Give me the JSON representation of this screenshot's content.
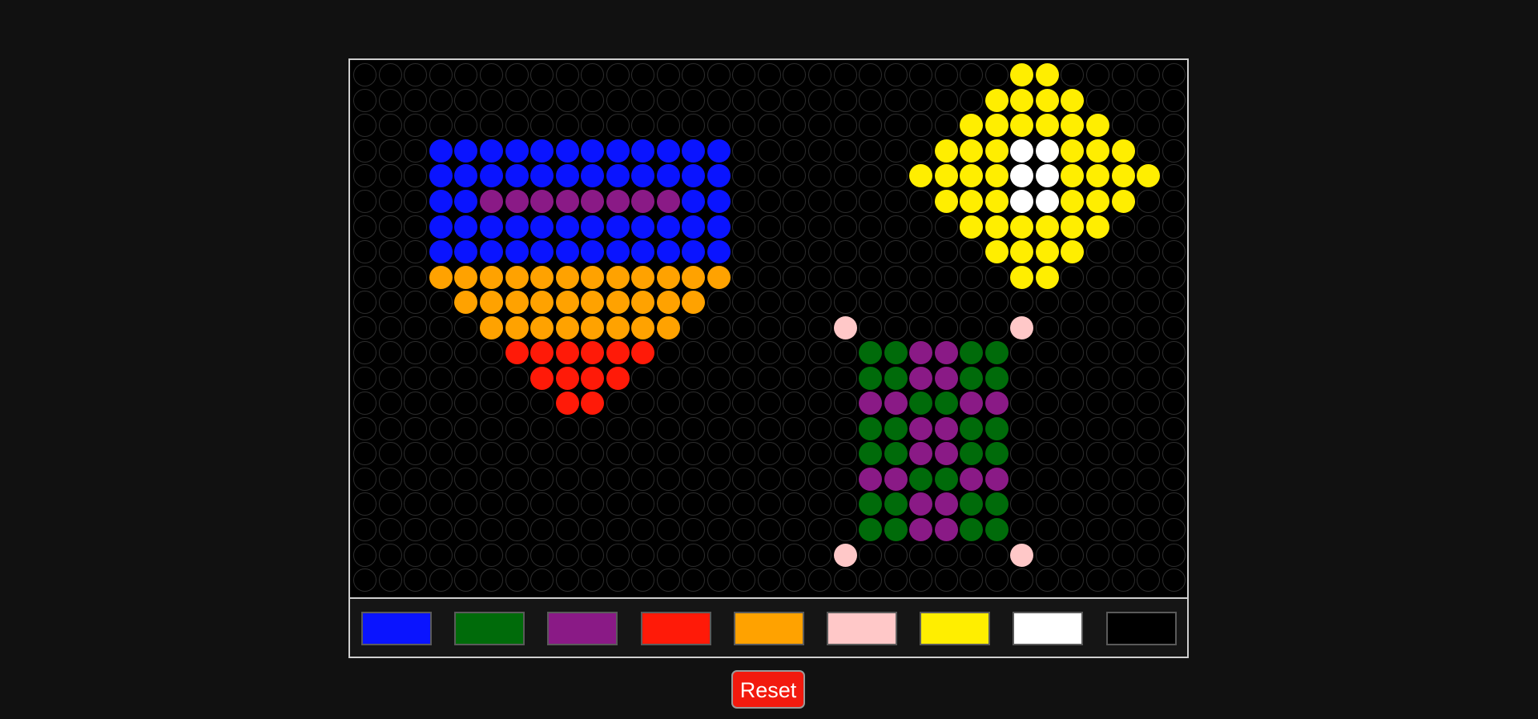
{
  "palette": {
    "colors": [
      {
        "name": "blue",
        "hex": "#0a14ff"
      },
      {
        "name": "green",
        "hex": "#006b0a"
      },
      {
        "name": "purple",
        "hex": "#8a1a86"
      },
      {
        "name": "red",
        "hex": "#ff1a08"
      },
      {
        "name": "orange",
        "hex": "#ffa200"
      },
      {
        "name": "pink",
        "hex": "#ffc8c8"
      },
      {
        "name": "yellow",
        "hex": "#ffee00"
      },
      {
        "name": "white",
        "hex": "#ffffff"
      },
      {
        "name": "black",
        "hex": "#000000"
      }
    ]
  },
  "board": {
    "columns": 33,
    "rows": 21,
    "pegs": [
      {
        "row": 0,
        "col": 26,
        "color": "yellow"
      },
      {
        "row": 0,
        "col": 27,
        "color": "yellow"
      },
      {
        "row": 1,
        "col": 25,
        "color": "yellow"
      },
      {
        "row": 1,
        "col": 26,
        "color": "yellow"
      },
      {
        "row": 1,
        "col": 27,
        "color": "yellow"
      },
      {
        "row": 1,
        "col": 28,
        "color": "yellow"
      },
      {
        "row": 2,
        "col": 24,
        "color": "yellow"
      },
      {
        "row": 2,
        "col": 25,
        "color": "yellow"
      },
      {
        "row": 2,
        "col": 26,
        "color": "yellow"
      },
      {
        "row": 2,
        "col": 27,
        "color": "yellow"
      },
      {
        "row": 2,
        "col": 28,
        "color": "yellow"
      },
      {
        "row": 2,
        "col": 29,
        "color": "yellow"
      },
      {
        "row": 3,
        "col": 3,
        "color": "blue"
      },
      {
        "row": 3,
        "col": 4,
        "color": "blue"
      },
      {
        "row": 3,
        "col": 5,
        "color": "blue"
      },
      {
        "row": 3,
        "col": 6,
        "color": "blue"
      },
      {
        "row": 3,
        "col": 7,
        "color": "blue"
      },
      {
        "row": 3,
        "col": 8,
        "color": "blue"
      },
      {
        "row": 3,
        "col": 9,
        "color": "blue"
      },
      {
        "row": 3,
        "col": 10,
        "color": "blue"
      },
      {
        "row": 3,
        "col": 11,
        "color": "blue"
      },
      {
        "row": 3,
        "col": 12,
        "color": "blue"
      },
      {
        "row": 3,
        "col": 13,
        "color": "blue"
      },
      {
        "row": 3,
        "col": 14,
        "color": "blue"
      },
      {
        "row": 3,
        "col": 23,
        "color": "yellow"
      },
      {
        "row": 3,
        "col": 24,
        "color": "yellow"
      },
      {
        "row": 3,
        "col": 25,
        "color": "yellow"
      },
      {
        "row": 3,
        "col": 26,
        "color": "white"
      },
      {
        "row": 3,
        "col": 27,
        "color": "white"
      },
      {
        "row": 3,
        "col": 28,
        "color": "yellow"
      },
      {
        "row": 3,
        "col": 29,
        "color": "yellow"
      },
      {
        "row": 3,
        "col": 30,
        "color": "yellow"
      },
      {
        "row": 4,
        "col": 3,
        "color": "blue"
      },
      {
        "row": 4,
        "col": 4,
        "color": "blue"
      },
      {
        "row": 4,
        "col": 5,
        "color": "blue"
      },
      {
        "row": 4,
        "col": 6,
        "color": "blue"
      },
      {
        "row": 4,
        "col": 7,
        "color": "blue"
      },
      {
        "row": 4,
        "col": 8,
        "color": "blue"
      },
      {
        "row": 4,
        "col": 9,
        "color": "blue"
      },
      {
        "row": 4,
        "col": 10,
        "color": "blue"
      },
      {
        "row": 4,
        "col": 11,
        "color": "blue"
      },
      {
        "row": 4,
        "col": 12,
        "color": "blue"
      },
      {
        "row": 4,
        "col": 13,
        "color": "blue"
      },
      {
        "row": 4,
        "col": 14,
        "color": "blue"
      },
      {
        "row": 4,
        "col": 22,
        "color": "yellow"
      },
      {
        "row": 4,
        "col": 23,
        "color": "yellow"
      },
      {
        "row": 4,
        "col": 24,
        "color": "yellow"
      },
      {
        "row": 4,
        "col": 25,
        "color": "yellow"
      },
      {
        "row": 4,
        "col": 26,
        "color": "white"
      },
      {
        "row": 4,
        "col": 27,
        "color": "white"
      },
      {
        "row": 4,
        "col": 28,
        "color": "yellow"
      },
      {
        "row": 4,
        "col": 29,
        "color": "yellow"
      },
      {
        "row": 4,
        "col": 30,
        "color": "yellow"
      },
      {
        "row": 4,
        "col": 31,
        "color": "yellow"
      },
      {
        "row": 5,
        "col": 3,
        "color": "blue"
      },
      {
        "row": 5,
        "col": 4,
        "color": "blue"
      },
      {
        "row": 5,
        "col": 5,
        "color": "purple"
      },
      {
        "row": 5,
        "col": 6,
        "color": "purple"
      },
      {
        "row": 5,
        "col": 7,
        "color": "purple"
      },
      {
        "row": 5,
        "col": 8,
        "color": "purple"
      },
      {
        "row": 5,
        "col": 9,
        "color": "purple"
      },
      {
        "row": 5,
        "col": 10,
        "color": "purple"
      },
      {
        "row": 5,
        "col": 11,
        "color": "purple"
      },
      {
        "row": 5,
        "col": 12,
        "color": "purple"
      },
      {
        "row": 5,
        "col": 13,
        "color": "blue"
      },
      {
        "row": 5,
        "col": 14,
        "color": "blue"
      },
      {
        "row": 5,
        "col": 23,
        "color": "yellow"
      },
      {
        "row": 5,
        "col": 24,
        "color": "yellow"
      },
      {
        "row": 5,
        "col": 25,
        "color": "yellow"
      },
      {
        "row": 5,
        "col": 26,
        "color": "white"
      },
      {
        "row": 5,
        "col": 27,
        "color": "white"
      },
      {
        "row": 5,
        "col": 28,
        "color": "yellow"
      },
      {
        "row": 5,
        "col": 29,
        "color": "yellow"
      },
      {
        "row": 5,
        "col": 30,
        "color": "yellow"
      },
      {
        "row": 6,
        "col": 3,
        "color": "blue"
      },
      {
        "row": 6,
        "col": 4,
        "color": "blue"
      },
      {
        "row": 6,
        "col": 5,
        "color": "blue"
      },
      {
        "row": 6,
        "col": 6,
        "color": "blue"
      },
      {
        "row": 6,
        "col": 7,
        "color": "blue"
      },
      {
        "row": 6,
        "col": 8,
        "color": "blue"
      },
      {
        "row": 6,
        "col": 9,
        "color": "blue"
      },
      {
        "row": 6,
        "col": 10,
        "color": "blue"
      },
      {
        "row": 6,
        "col": 11,
        "color": "blue"
      },
      {
        "row": 6,
        "col": 12,
        "color": "blue"
      },
      {
        "row": 6,
        "col": 13,
        "color": "blue"
      },
      {
        "row": 6,
        "col": 14,
        "color": "blue"
      },
      {
        "row": 6,
        "col": 24,
        "color": "yellow"
      },
      {
        "row": 6,
        "col": 25,
        "color": "yellow"
      },
      {
        "row": 6,
        "col": 26,
        "color": "yellow"
      },
      {
        "row": 6,
        "col": 27,
        "color": "yellow"
      },
      {
        "row": 6,
        "col": 28,
        "color": "yellow"
      },
      {
        "row": 6,
        "col": 29,
        "color": "yellow"
      },
      {
        "row": 7,
        "col": 3,
        "color": "blue"
      },
      {
        "row": 7,
        "col": 4,
        "color": "blue"
      },
      {
        "row": 7,
        "col": 5,
        "color": "blue"
      },
      {
        "row": 7,
        "col": 6,
        "color": "blue"
      },
      {
        "row": 7,
        "col": 7,
        "color": "blue"
      },
      {
        "row": 7,
        "col": 8,
        "color": "blue"
      },
      {
        "row": 7,
        "col": 9,
        "color": "blue"
      },
      {
        "row": 7,
        "col": 10,
        "color": "blue"
      },
      {
        "row": 7,
        "col": 11,
        "color": "blue"
      },
      {
        "row": 7,
        "col": 12,
        "color": "blue"
      },
      {
        "row": 7,
        "col": 13,
        "color": "blue"
      },
      {
        "row": 7,
        "col": 14,
        "color": "blue"
      },
      {
        "row": 7,
        "col": 25,
        "color": "yellow"
      },
      {
        "row": 7,
        "col": 26,
        "color": "yellow"
      },
      {
        "row": 7,
        "col": 27,
        "color": "yellow"
      },
      {
        "row": 7,
        "col": 28,
        "color": "yellow"
      },
      {
        "row": 8,
        "col": 3,
        "color": "orange"
      },
      {
        "row": 8,
        "col": 4,
        "color": "orange"
      },
      {
        "row": 8,
        "col": 5,
        "color": "orange"
      },
      {
        "row": 8,
        "col": 6,
        "color": "orange"
      },
      {
        "row": 8,
        "col": 7,
        "color": "orange"
      },
      {
        "row": 8,
        "col": 8,
        "color": "orange"
      },
      {
        "row": 8,
        "col": 9,
        "color": "orange"
      },
      {
        "row": 8,
        "col": 10,
        "color": "orange"
      },
      {
        "row": 8,
        "col": 11,
        "color": "orange"
      },
      {
        "row": 8,
        "col": 12,
        "color": "orange"
      },
      {
        "row": 8,
        "col": 13,
        "color": "orange"
      },
      {
        "row": 8,
        "col": 14,
        "color": "orange"
      },
      {
        "row": 8,
        "col": 26,
        "color": "yellow"
      },
      {
        "row": 8,
        "col": 27,
        "color": "yellow"
      },
      {
        "row": 9,
        "col": 4,
        "color": "orange"
      },
      {
        "row": 9,
        "col": 5,
        "color": "orange"
      },
      {
        "row": 9,
        "col": 6,
        "color": "orange"
      },
      {
        "row": 9,
        "col": 7,
        "color": "orange"
      },
      {
        "row": 9,
        "col": 8,
        "color": "orange"
      },
      {
        "row": 9,
        "col": 9,
        "color": "orange"
      },
      {
        "row": 9,
        "col": 10,
        "color": "orange"
      },
      {
        "row": 9,
        "col": 11,
        "color": "orange"
      },
      {
        "row": 9,
        "col": 12,
        "color": "orange"
      },
      {
        "row": 9,
        "col": 13,
        "color": "orange"
      },
      {
        "row": 10,
        "col": 5,
        "color": "orange"
      },
      {
        "row": 10,
        "col": 6,
        "color": "orange"
      },
      {
        "row": 10,
        "col": 7,
        "color": "orange"
      },
      {
        "row": 10,
        "col": 8,
        "color": "orange"
      },
      {
        "row": 10,
        "col": 9,
        "color": "orange"
      },
      {
        "row": 10,
        "col": 10,
        "color": "orange"
      },
      {
        "row": 10,
        "col": 11,
        "color": "orange"
      },
      {
        "row": 10,
        "col": 12,
        "color": "orange"
      },
      {
        "row": 10,
        "col": 19,
        "color": "pink"
      },
      {
        "row": 10,
        "col": 26,
        "color": "pink"
      },
      {
        "row": 11,
        "col": 6,
        "color": "red"
      },
      {
        "row": 11,
        "col": 7,
        "color": "red"
      },
      {
        "row": 11,
        "col": 8,
        "color": "red"
      },
      {
        "row": 11,
        "col": 9,
        "color": "red"
      },
      {
        "row": 11,
        "col": 10,
        "color": "red"
      },
      {
        "row": 11,
        "col": 11,
        "color": "red"
      },
      {
        "row": 11,
        "col": 20,
        "color": "green"
      },
      {
        "row": 11,
        "col": 21,
        "color": "green"
      },
      {
        "row": 11,
        "col": 22,
        "color": "purple"
      },
      {
        "row": 11,
        "col": 23,
        "color": "purple"
      },
      {
        "row": 11,
        "col": 24,
        "color": "green"
      },
      {
        "row": 11,
        "col": 25,
        "color": "green"
      },
      {
        "row": 12,
        "col": 7,
        "color": "red"
      },
      {
        "row": 12,
        "col": 8,
        "color": "red"
      },
      {
        "row": 12,
        "col": 9,
        "color": "red"
      },
      {
        "row": 12,
        "col": 10,
        "color": "red"
      },
      {
        "row": 12,
        "col": 20,
        "color": "green"
      },
      {
        "row": 12,
        "col": 21,
        "color": "green"
      },
      {
        "row": 12,
        "col": 22,
        "color": "purple"
      },
      {
        "row": 12,
        "col": 23,
        "color": "purple"
      },
      {
        "row": 12,
        "col": 24,
        "color": "green"
      },
      {
        "row": 12,
        "col": 25,
        "color": "green"
      },
      {
        "row": 13,
        "col": 8,
        "color": "red"
      },
      {
        "row": 13,
        "col": 9,
        "color": "red"
      },
      {
        "row": 13,
        "col": 20,
        "color": "purple"
      },
      {
        "row": 13,
        "col": 21,
        "color": "purple"
      },
      {
        "row": 13,
        "col": 22,
        "color": "green"
      },
      {
        "row": 13,
        "col": 23,
        "color": "green"
      },
      {
        "row": 13,
        "col": 24,
        "color": "purple"
      },
      {
        "row": 13,
        "col": 25,
        "color": "purple"
      },
      {
        "row": 14,
        "col": 20,
        "color": "green"
      },
      {
        "row": 14,
        "col": 21,
        "color": "green"
      },
      {
        "row": 14,
        "col": 22,
        "color": "purple"
      },
      {
        "row": 14,
        "col": 23,
        "color": "purple"
      },
      {
        "row": 14,
        "col": 24,
        "color": "green"
      },
      {
        "row": 14,
        "col": 25,
        "color": "green"
      },
      {
        "row": 15,
        "col": 20,
        "color": "green"
      },
      {
        "row": 15,
        "col": 21,
        "color": "green"
      },
      {
        "row": 15,
        "col": 22,
        "color": "purple"
      },
      {
        "row": 15,
        "col": 23,
        "color": "purple"
      },
      {
        "row": 15,
        "col": 24,
        "color": "green"
      },
      {
        "row": 15,
        "col": 25,
        "color": "green"
      },
      {
        "row": 16,
        "col": 20,
        "color": "purple"
      },
      {
        "row": 16,
        "col": 21,
        "color": "purple"
      },
      {
        "row": 16,
        "col": 22,
        "color": "green"
      },
      {
        "row": 16,
        "col": 23,
        "color": "green"
      },
      {
        "row": 16,
        "col": 24,
        "color": "purple"
      },
      {
        "row": 16,
        "col": 25,
        "color": "purple"
      },
      {
        "row": 17,
        "col": 20,
        "color": "green"
      },
      {
        "row": 17,
        "col": 21,
        "color": "green"
      },
      {
        "row": 17,
        "col": 22,
        "color": "purple"
      },
      {
        "row": 17,
        "col": 23,
        "color": "purple"
      },
      {
        "row": 17,
        "col": 24,
        "color": "green"
      },
      {
        "row": 17,
        "col": 25,
        "color": "green"
      },
      {
        "row": 18,
        "col": 20,
        "color": "green"
      },
      {
        "row": 18,
        "col": 21,
        "color": "green"
      },
      {
        "row": 18,
        "col": 22,
        "color": "purple"
      },
      {
        "row": 18,
        "col": 23,
        "color": "purple"
      },
      {
        "row": 18,
        "col": 24,
        "color": "green"
      },
      {
        "row": 18,
        "col": 25,
        "color": "green"
      },
      {
        "row": 19,
        "col": 19,
        "color": "pink"
      },
      {
        "row": 19,
        "col": 26,
        "color": "pink"
      }
    ]
  },
  "controls": {
    "reset_label": "Reset"
  }
}
